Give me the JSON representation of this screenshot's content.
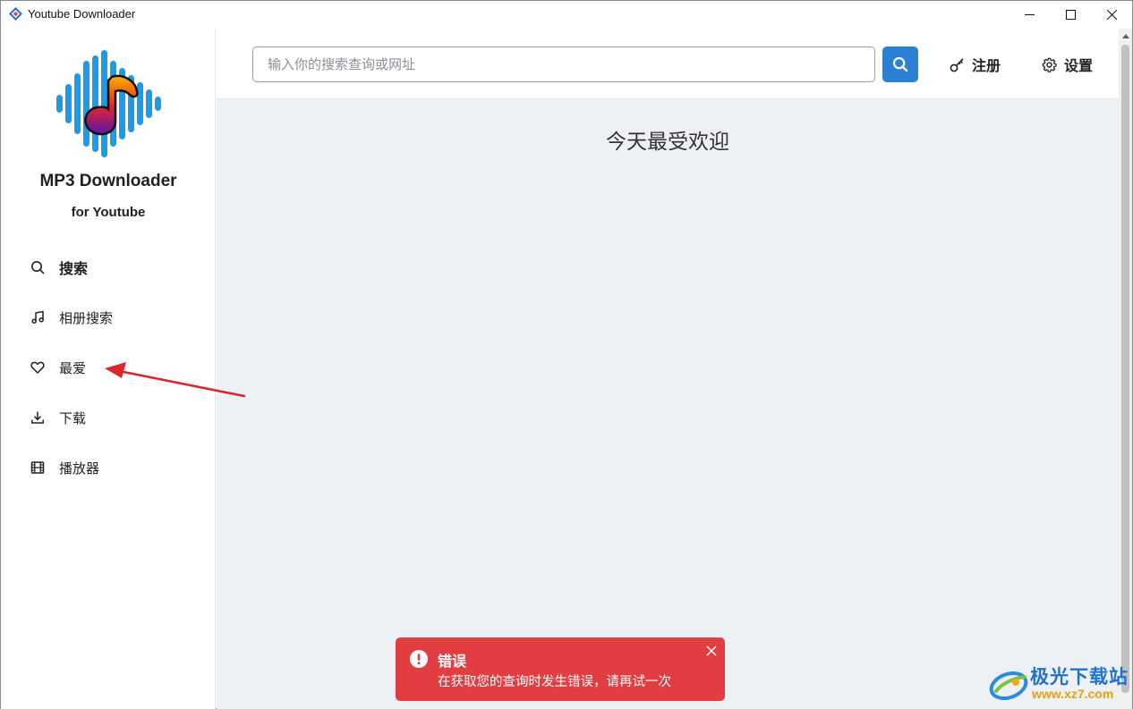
{
  "window": {
    "title": "Youtube Downloader"
  },
  "sidebar": {
    "brand_title": "MP3 Downloader",
    "brand_subtitle": "for Youtube",
    "items": [
      {
        "label": "搜索",
        "icon": "search-icon",
        "active": true
      },
      {
        "label": "相册搜索",
        "icon": "music-note-icon",
        "active": false
      },
      {
        "label": "最爱",
        "icon": "heart-icon",
        "active": false
      },
      {
        "label": "下载",
        "icon": "download-icon",
        "active": false
      },
      {
        "label": "播放器",
        "icon": "film-icon",
        "active": false
      }
    ]
  },
  "topbar": {
    "search_placeholder": "输入你的搜索查询或网址",
    "search_value": "",
    "register_label": "注册",
    "settings_label": "设置"
  },
  "main": {
    "heading": "今天最受欢迎"
  },
  "toast": {
    "title": "错误",
    "message": "在获取您的查询时发生错误，请再试一次"
  },
  "watermark": {
    "text": "极光下载站",
    "url": "www.xz7.com"
  },
  "colors": {
    "accent": "#2d7fd3",
    "error": "#e23e42",
    "main_bg": "#edf1f5"
  }
}
